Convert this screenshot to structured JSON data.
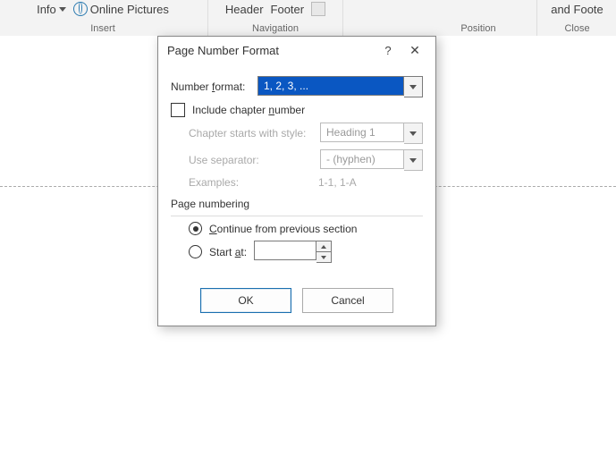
{
  "ribbon": {
    "info_label": "Info",
    "online_pics": "Online Pictures",
    "insert_group": "Insert",
    "header": "Header",
    "footer": "Footer",
    "nav_group": "Navigation",
    "position_group": "Position",
    "and_foot": "and Foote",
    "close_group": "Close"
  },
  "dialog": {
    "title": "Page Number Format",
    "help": "?",
    "number_format_label_pre": "Number ",
    "number_format_label_u": "f",
    "number_format_label_post": "ormat:",
    "number_format_value": "1, 2, 3, ...",
    "include_chapter_pre": "Include chapter ",
    "include_chapter_u": "n",
    "include_chapter_post": "umber",
    "chapter_style_label": "Chapter starts with style:",
    "chapter_style_value": "Heading 1",
    "separator_label": "Use separator:",
    "separator_value": "-   (hyphen)",
    "examples_label": "Examples:",
    "examples_value": "1-1, 1-A",
    "page_numbering": "Page numbering",
    "continue_pre": "",
    "continue_u": "C",
    "continue_post": "ontinue from previous section",
    "start_at_pre": "Start ",
    "start_at_u": "a",
    "start_at_post": "t:",
    "start_at_value": "",
    "ok": "OK",
    "cancel": "Cancel"
  }
}
